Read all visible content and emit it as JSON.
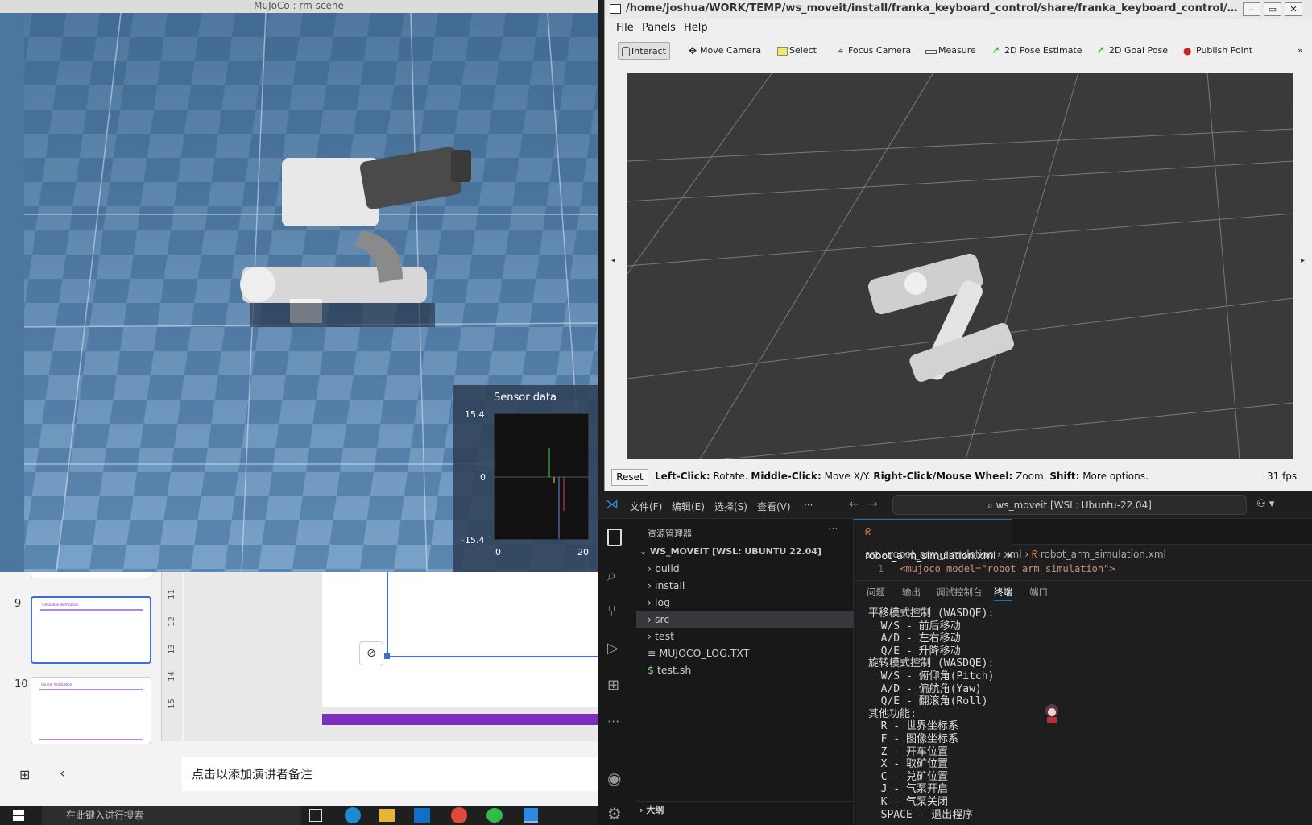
{
  "mujoco": {
    "title": "MuJoCo : rm scene",
    "sensor": {
      "title": "Sensor data",
      "y_max": "15.4",
      "y_mid": "0",
      "y_min": "-15.4",
      "x_min": "0",
      "x_max": "20"
    }
  },
  "rviz": {
    "title": "/home/joshua/WORK/TEMP/ws_moveit/install/franka_keyboard_control/share/franka_keyboard_control/c...",
    "menu": [
      "File",
      "Panels",
      "Help"
    ],
    "tools": [
      {
        "label": "Interact",
        "icon": "hand-cursor-icon"
      },
      {
        "label": "Move Camera",
        "icon": "move-arrows-icon"
      },
      {
        "label": "Select",
        "icon": "select-box-icon"
      },
      {
        "label": "Focus Camera",
        "icon": "crosshair-icon"
      },
      {
        "label": "Measure",
        "icon": "ruler-icon"
      },
      {
        "label": "2D Pose Estimate",
        "icon": "green-arrow-icon"
      },
      {
        "label": "2D Goal Pose",
        "icon": "green-arrow-icon"
      },
      {
        "label": "Publish Point",
        "icon": "map-pin-icon"
      }
    ],
    "reset_label": "Reset",
    "status": {
      "b1": "Left-Click:",
      "t1": " Rotate. ",
      "b2": "Middle-Click:",
      "t2": " Move X/Y. ",
      "b3": "Right-Click/Mouse Wheel:",
      "t3": " Zoom. ",
      "b4": "Shift:",
      "t4": " More options."
    },
    "fps": "31 fps"
  },
  "ppt": {
    "slides": [
      {
        "num": "9",
        "title": "Simulation Verification"
      },
      {
        "num": "10",
        "title": "Control Verification"
      }
    ],
    "ruler": [
      "11",
      "12",
      "13",
      "14",
      "15"
    ],
    "notes_placeholder": "点击以添加演讲者备注"
  },
  "taskbar": {
    "search_placeholder": "在此键入进行搜索"
  },
  "vscode": {
    "menu": [
      "文件(F)",
      "编辑(E)",
      "选择(S)",
      "查看(V)",
      "···"
    ],
    "command_center": "ws_moveit [WSL: Ubuntu-22.04]",
    "explorer_title": "资源管理器",
    "workspace": "WS_MOVEIT [WSL: UBUNTU 22.04]",
    "tree": [
      {
        "name": "build",
        "type": "folder"
      },
      {
        "name": "install",
        "type": "folder"
      },
      {
        "name": "log",
        "type": "folder"
      },
      {
        "name": "src",
        "type": "folder"
      },
      {
        "name": "test",
        "type": "folder"
      },
      {
        "name": "MUJOCO_LOG.TXT",
        "type": "file"
      },
      {
        "name": "test.sh",
        "type": "file"
      }
    ],
    "outline_label": "大纲",
    "tab": "robot_arm_simulation.xml",
    "breadcrumb": [
      "src",
      "robot_arm_simulation",
      "xml",
      "robot_arm_simulation.xml"
    ],
    "code_line_num": "1",
    "code_line": "<mujoco model=\"robot_arm_simulation\">",
    "panel_tabs": [
      "问题",
      "输出",
      "调试控制台",
      "终端",
      "端口"
    ],
    "active_panel": "终端",
    "terminal_lines": [
      "平移模式控制 (WASDQE):",
      "  W/S - 前后移动",
      "  A/D - 左右移动",
      "  Q/E - 升降移动",
      "旋转模式控制 (WASDQE):",
      "  W/S - 俯仰角(Pitch)",
      "  A/D - 偏航角(Yaw)",
      "  Q/E - 翻滚角(Roll)",
      "其他功能:",
      "  R - 世界坐标系",
      "  F - 图像坐标系",
      "  Z - 开车位置",
      "  X - 取矿位置",
      "  C - 兑矿位置",
      "  J - 气泵开启",
      "  K - 气泵关闭",
      "  SPACE - 退出程序"
    ]
  },
  "colors": {
    "vscode_accent": "#0078d4",
    "ppt_accent": "#7b2fbe",
    "floor_light": "#6a93bb",
    "floor_dark": "#3e6890"
  }
}
